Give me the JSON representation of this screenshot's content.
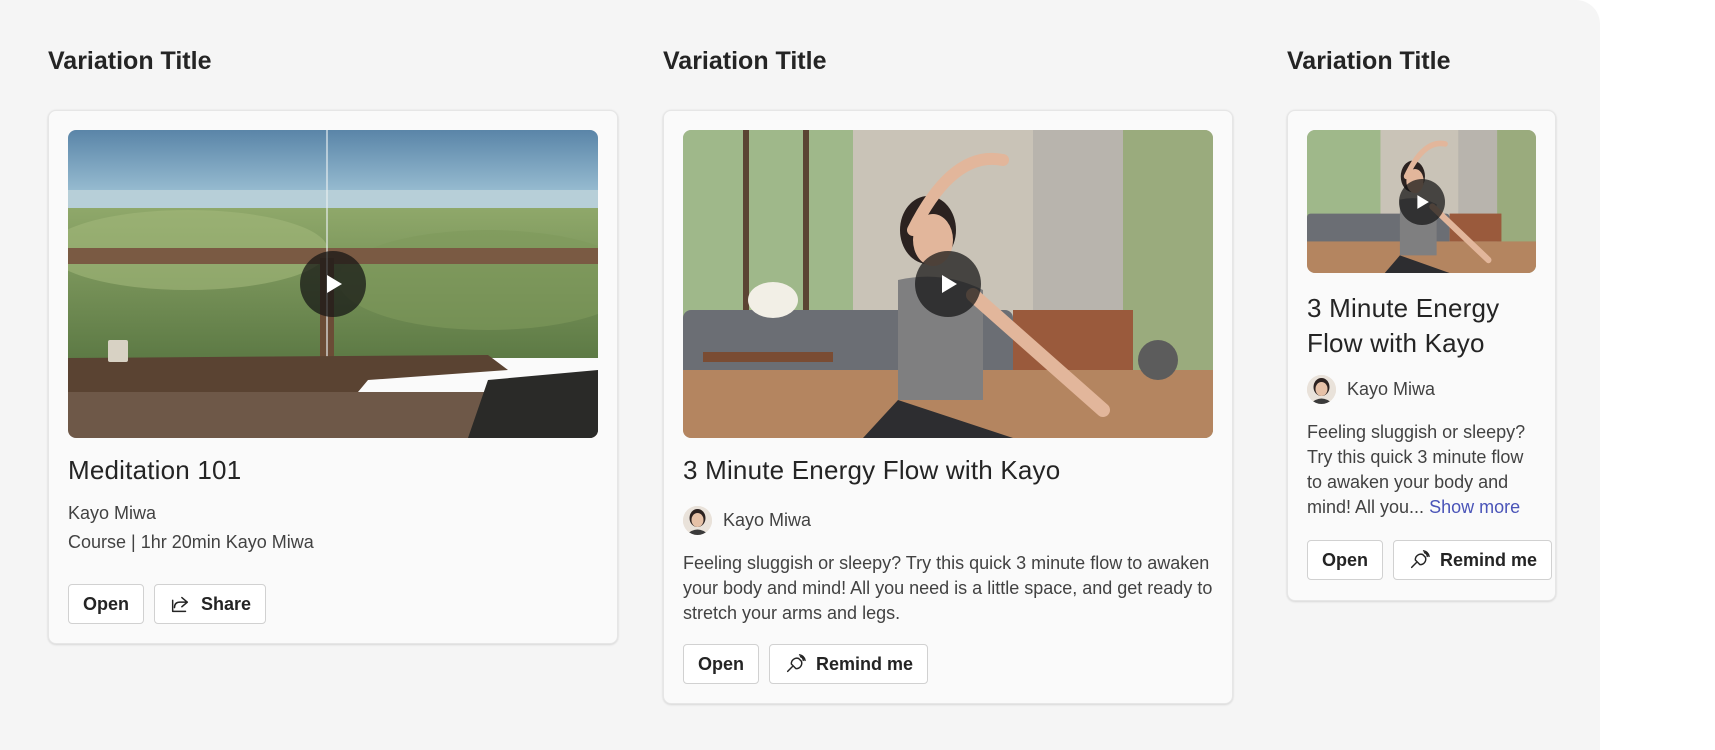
{
  "variations": [
    {
      "heading": "Variation Title",
      "image": "ocean-deck-photo",
      "title": "Meditation 101",
      "author": "Kayo Miwa",
      "meta_line": "Course | 1hr 20min Kayo Miwa",
      "buttons": {
        "open": "Open",
        "secondary": "Share"
      },
      "secondary_icon": "share-icon"
    },
    {
      "heading": "Variation Title",
      "image": "yoga-living-room-photo",
      "title": "3 Minute Energy Flow with Kayo",
      "author": "Kayo Miwa",
      "description": "Feeling sluggish or sleepy? Try this quick 3 minute flow to awaken your body and mind! All you need is a little space, and get ready to stretch your arms and legs.",
      "buttons": {
        "open": "Open",
        "secondary": "Remind me"
      },
      "secondary_icon": "alarm-icon"
    },
    {
      "heading": "Variation Title",
      "image": "yoga-living-room-photo",
      "title_lines": [
        "3 Minute Energy",
        "Flow with Kayo"
      ],
      "author": "Kayo Miwa",
      "description_lines": [
        "Feeling sluggish or sleepy?",
        "Try this quick 3 minute flow",
        "to awaken your body and",
        "mind! All you..."
      ],
      "show_more": "Show more",
      "buttons": {
        "open": "Open",
        "secondary": "Remind me"
      },
      "secondary_icon": "alarm-icon"
    }
  ],
  "colors": {
    "link": "#4a54b8",
    "canvas": "#f5f5f5",
    "card": "#fafafa"
  }
}
